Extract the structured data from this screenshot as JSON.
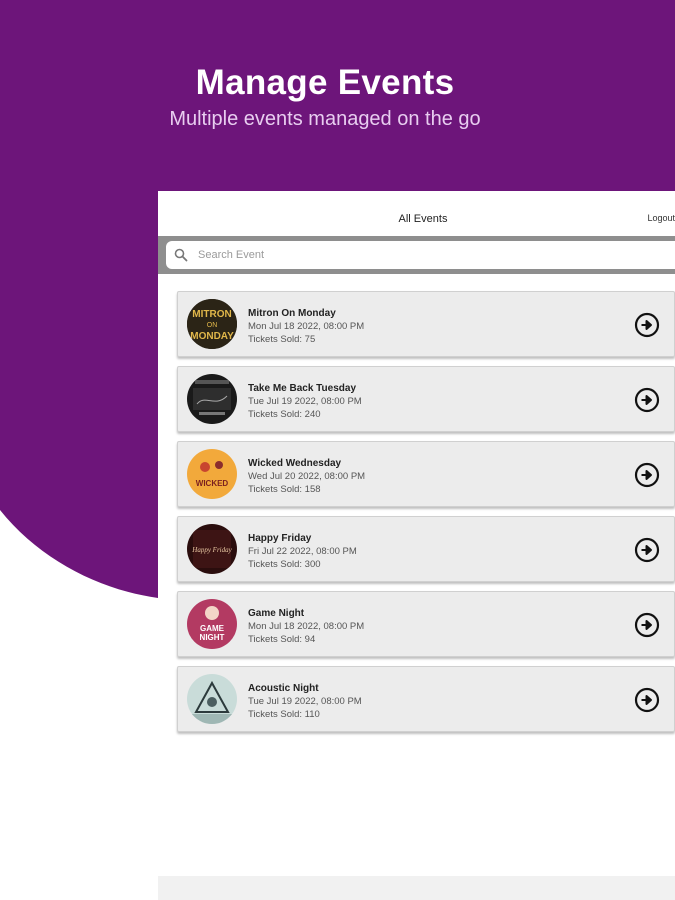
{
  "colors": {
    "brand": "#6d157a",
    "hero_sub": "#e8cdf0",
    "card_bg": "#ececec"
  },
  "hero": {
    "title": "Manage Events",
    "subtitle": "Multiple events managed on the go"
  },
  "app": {
    "title": "All Events",
    "logout": "Logout",
    "search": {
      "placeholder": "Search Event",
      "icon": "search-icon"
    }
  },
  "events": [
    {
      "name": "Mitron On Monday",
      "date": "Mon Jul 18 2022, 08:00 PM",
      "tickets": "Tickets Sold: 75",
      "icon": "arrow-circle-right-icon"
    },
    {
      "name": "Take Me Back Tuesday",
      "date": "Tue Jul 19 2022, 08:00 PM",
      "tickets": "Tickets Sold: 240",
      "icon": "arrow-circle-right-icon"
    },
    {
      "name": "Wicked Wednesday",
      "date": "Wed Jul 20 2022, 08:00 PM",
      "tickets": "Tickets Sold: 158",
      "icon": "arrow-circle-right-icon"
    },
    {
      "name": "Happy Friday",
      "date": "Fri Jul 22 2022, 08:00 PM",
      "tickets": "Tickets Sold: 300",
      "icon": "arrow-circle-right-icon"
    },
    {
      "name": "Game Night",
      "date": "Mon Jul 18 2022, 08:00 PM",
      "tickets": "Tickets Sold: 94",
      "icon": "arrow-circle-right-icon"
    },
    {
      "name": "Acoustic Night",
      "date": "Tue Jul 19 2022, 08:00 PM",
      "tickets": "Tickets Sold: 110",
      "icon": "arrow-circle-right-icon"
    }
  ],
  "thumb_text": {
    "mitron": [
      "MITRON",
      "ON",
      "MONDAY"
    ],
    "wicked": "WICKED",
    "happy": "Happy Friday",
    "game": [
      "GAME",
      "NIGHT"
    ]
  }
}
